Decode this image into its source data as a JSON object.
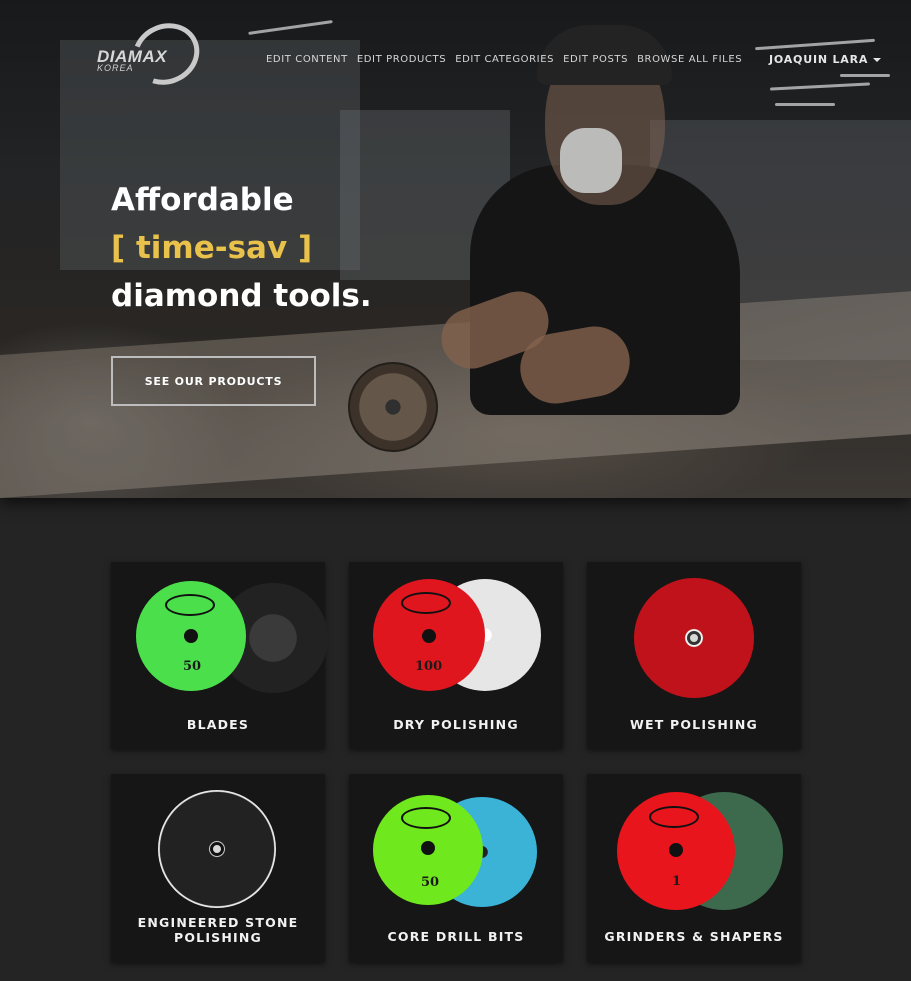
{
  "header": {
    "logo": {
      "name": "DIAMAX",
      "sub": "KOREA"
    },
    "nav": [
      {
        "label": "EDIT CONTENT"
      },
      {
        "label": "EDIT PRODUCTS"
      },
      {
        "label": "EDIT CATEGORIES"
      },
      {
        "label": "EDIT POSTS"
      },
      {
        "label": "BROWSE ALL FILES"
      }
    ],
    "user": {
      "name": "JOAQUIN LARA"
    }
  },
  "hero": {
    "line1": "Affordable",
    "line2": "[ time-sav ]",
    "line3": "diamond tools.",
    "accent_color": "#e8c24a",
    "cta_label": "SEE OUR PRODUCTS"
  },
  "categories": [
    {
      "label": "BLADES",
      "grit": "50",
      "pad_color": "#4be04b",
      "back_color": "#2d2d2d"
    },
    {
      "label": "DRY POLISHING",
      "grit": "100",
      "pad_color": "#e0161e",
      "back_color": "#e6e6e6"
    },
    {
      "label": "WET POLISHING",
      "pad_color": "#c0121a"
    },
    {
      "label": "ENGINEERED STONE POLISHING",
      "label_line1": "ENGINEERED STONE",
      "label_line2": "POLISHING",
      "pad_color": "#222222"
    },
    {
      "label": "CORE DRILL BITS",
      "grit": "50",
      "pad_color": "#6fe81e",
      "back_color": "#3ab3d6"
    },
    {
      "label": "GRINDERS & SHAPERS",
      "grit": "1",
      "pad_color": "#e8151d",
      "back_color": "#3d6a4d"
    }
  ]
}
